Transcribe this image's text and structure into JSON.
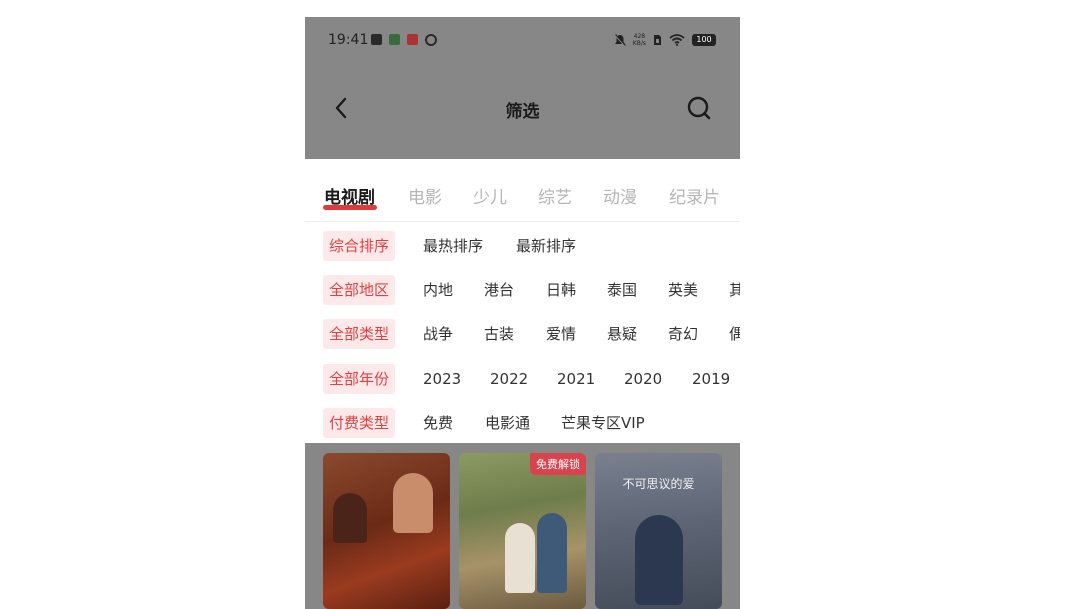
{
  "status_bar": {
    "time": "19:41",
    "net_speed_value": "428",
    "net_speed_unit": "KB/s",
    "battery": "100",
    "icons_left": [
      "sim-card-icon",
      "app-notification-icon",
      "news-app-icon",
      "link-icon"
    ],
    "icons_right": [
      "mute-bell-icon",
      "sim-icon",
      "wifi-icon",
      "battery-icon"
    ]
  },
  "header": {
    "title": "筛选",
    "back_icon": "chevron-left-icon",
    "search_icon": "search-icon"
  },
  "tabs": [
    {
      "label": "电视剧",
      "active": true
    },
    {
      "label": "电影",
      "active": false
    },
    {
      "label": "少儿",
      "active": false
    },
    {
      "label": "综艺",
      "active": false
    },
    {
      "label": "动漫",
      "active": false
    },
    {
      "label": "纪录片",
      "active": false
    }
  ],
  "filters": {
    "sort": {
      "label": "综合排序",
      "options": [
        "最热排序",
        "最新排序"
      ]
    },
    "region": {
      "label": "全部地区",
      "options": [
        "内地",
        "港台",
        "日韩",
        "泰国",
        "英美",
        "其"
      ]
    },
    "genre": {
      "label": "全部类型",
      "options": [
        "战争",
        "古装",
        "爱情",
        "悬疑",
        "奇幻",
        "偶"
      ]
    },
    "year": {
      "label": "全部年份",
      "options": [
        "2023",
        "2022",
        "2021",
        "2020",
        "2019"
      ]
    },
    "pay": {
      "label": "付费类型",
      "options": [
        "免费",
        "电影通",
        "芒果专区VIP"
      ]
    }
  },
  "posters": [
    {
      "badge": "",
      "title": ""
    },
    {
      "badge": "免费解锁",
      "title": ""
    },
    {
      "badge": "",
      "title": "不可思议的爱"
    }
  ],
  "colors": {
    "accent": "#e03a3a",
    "label_bg": "#fde9e9",
    "overlay": "#878787"
  }
}
